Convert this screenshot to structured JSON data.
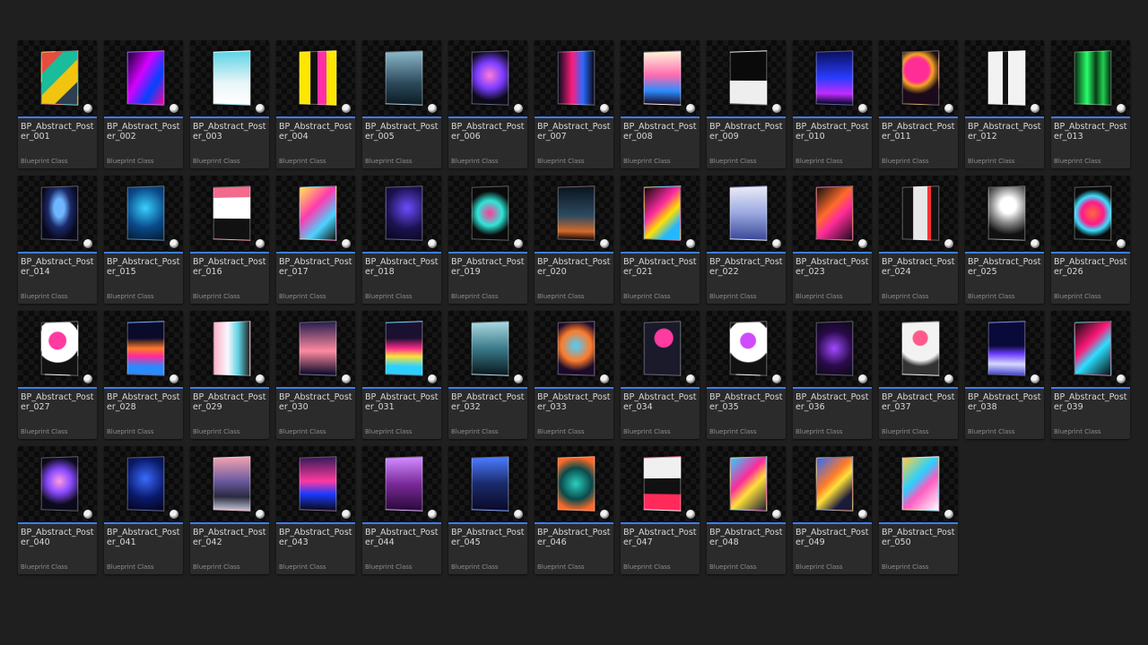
{
  "type_label": "Blueprint Class",
  "assets": [
    {
      "name": "BP_Abstract_Poster_001",
      "poster": "linear-gradient(135deg,#e74c3c 0 25%,#1abc9c 25% 50%,#f1c40f 50% 75%,#2c3e50 75%)"
    },
    {
      "name": "BP_Abstract_Poster_002",
      "poster": "linear-gradient(120deg,#1a0030,#d400ff 40%,#0044ff 70%,#ff0099)"
    },
    {
      "name": "BP_Abstract_Poster_003",
      "poster": "linear-gradient(180deg,#5fd3e6,#e9f6f8 60%,#ffffff)"
    },
    {
      "name": "BP_Abstract_Poster_004",
      "poster": "linear-gradient(90deg,#ffe600 0 30%,#111 30% 50%,#ff2ea6 50% 75%,#ffe600 75%)"
    },
    {
      "name": "BP_Abstract_Poster_005",
      "poster": "linear-gradient(180deg,#8ab6c8,#2c4a5c 60%,#0d1c26)"
    },
    {
      "name": "BP_Abstract_Poster_006",
      "poster": "radial-gradient(circle at 50% 45%,#ff7ad9,#7a3cff 40%,#0a0a18 75%)"
    },
    {
      "name": "BP_Abstract_Poster_007",
      "poster": "linear-gradient(90deg,#0a0a1a,#ff1c7d 40%,#2b6bff 70%,#0a0a1a)"
    },
    {
      "name": "BP_Abstract_Poster_008",
      "poster": "linear-gradient(180deg,#fef2d8,#ff6ab0 45%,#2b8cff 75%,#1a0a2a)"
    },
    {
      "name": "BP_Abstract_Poster_009",
      "poster": "linear-gradient(180deg,#0a0a0a 0 55%,#eeeeee 55%)"
    },
    {
      "name": "BP_Abstract_Poster_010",
      "poster": "linear-gradient(180deg,#0a1060,#2a3dff 50%,#c02cff 80%,#05052a)"
    },
    {
      "name": "BP_Abstract_Poster_011",
      "poster": "radial-gradient(circle at 40% 35%,#ff2d95 0 30%,#f5a623 40%,#1a0a1a 60%)"
    },
    {
      "name": "BP_Abstract_Poster_012",
      "poster": "linear-gradient(90deg,#f2f2f2 0 40%,#111 40% 55%,#f2f2f2 55%)"
    },
    {
      "name": "BP_Abstract_Poster_013",
      "poster": "linear-gradient(90deg,#062b10,#2aff6a 35%,#0a3a15 60%,#1fd04f 80%,#062b10)"
    },
    {
      "name": "BP_Abstract_Poster_014",
      "poster": "radial-gradient(ellipse at 50% 40%,#6fb6ff 0 20%,#1b2a6a 45%,#08081a 75%)"
    },
    {
      "name": "BP_Abstract_Poster_015",
      "poster": "radial-gradient(circle at 50% 40%,#38d0ff,#0a4a8a 55%,#041a33)"
    },
    {
      "name": "BP_Abstract_Poster_016",
      "poster": "linear-gradient(180deg,#f36b8c 0 20%,#ffffff 20% 60%,#111 60%)"
    },
    {
      "name": "BP_Abstract_Poster_017",
      "poster": "linear-gradient(135deg,#ffe84a,#ff3ab0 40%,#4ad3ff 70%,#111)"
    },
    {
      "name": "BP_Abstract_Poster_018",
      "poster": "radial-gradient(circle at 60% 40%,#6c4cff,#1b1250 55%,#06061a)"
    },
    {
      "name": "BP_Abstract_Poster_019",
      "poster": "radial-gradient(circle at 50% 50%,#ff3a9a,#2ee6d6 40%,#0a0a0a 70%)"
    },
    {
      "name": "BP_Abstract_Poster_020",
      "poster": "linear-gradient(180deg,#0a1520,#2d4a60 55%,#d46a2a 85%,#1a0a0a)"
    },
    {
      "name": "BP_Abstract_Poster_021",
      "poster": "linear-gradient(135deg,#0a0a0a,#ff2aa0 40%,#ffe100 60%,#25b7ff 80%)"
    },
    {
      "name": "BP_Abstract_Poster_022",
      "poster": "linear-gradient(180deg,#e8eaf6,#9aa8e0 50%,#3c4a9a)"
    },
    {
      "name": "BP_Abstract_Poster_023",
      "poster": "linear-gradient(135deg,#111,#ff6a2a 40%,#ff2a9a 60%,#1a0a1a)"
    },
    {
      "name": "BP_Abstract_Poster_024",
      "poster": "linear-gradient(90deg,#111 0 30%,#e8e8e8 30% 70%,#ff3030 70% 80%,#111 80%)"
    },
    {
      "name": "BP_Abstract_Poster_025",
      "poster": "radial-gradient(circle at 55% 35%,#ffffff 0 20%,#8a8a8a 45%,#111 75%)"
    },
    {
      "name": "BP_Abstract_Poster_026",
      "poster": "radial-gradient(circle at 50% 50%,#ff6a3a,#ff1a8a 35%,#3ae0ff 55%,#0a0a0a 75%)"
    },
    {
      "name": "BP_Abstract_Poster_027",
      "poster": "radial-gradient(circle at 45% 35%,#ff3aa0 0 22%,#ffffff 24% 55%,#111 57%)"
    },
    {
      "name": "BP_Abstract_Poster_028",
      "poster": "linear-gradient(180deg,#0a0a2a 0 30%,#ff7a2a 50%,#ff2a9a 65%,#2a8aff 85%)"
    },
    {
      "name": "BP_Abstract_Poster_029",
      "poster": "linear-gradient(90deg,#ffb0c8,#f8f8ff 40%,#5ad0e0 70%,#222)"
    },
    {
      "name": "BP_Abstract_Poster_030",
      "poster": "linear-gradient(180deg,#2a2050,#ff8aa0 55%,#0a0a2a)"
    },
    {
      "name": "BP_Abstract_Poster_031",
      "poster": "linear-gradient(180deg,#1a1030 0 30%,#ff2a8a 50%,#ffe13a 65%,#2ad0ff 85%)"
    },
    {
      "name": "BP_Abstract_Poster_032",
      "poster": "linear-gradient(180deg,#a8d8e0,#3a7a8a 50%,#0a1a20)"
    },
    {
      "name": "BP_Abstract_Poster_033",
      "poster": "radial-gradient(circle at 50% 45%,#4ad0ff,#ff7a2a 45%,#1a0a2a 75%)"
    },
    {
      "name": "BP_Abstract_Poster_034",
      "poster": "radial-gradient(circle at 55% 30%,#ff3aa0 0 22%,#1a1a2a 24%)"
    },
    {
      "name": "BP_Abstract_Poster_035",
      "poster": "radial-gradient(circle at 50% 35%,#d04aff 0 20%,#ffffff 22% 55%,#111 58%)"
    },
    {
      "name": "BP_Abstract_Poster_036",
      "poster": "radial-gradient(circle at 50% 50%,#a04aff,#2a0a4a 55%,#0a0a14)"
    },
    {
      "name": "BP_Abstract_Poster_037",
      "poster": "radial-gradient(circle at 50% 30%,#ff5a8a 0 18%,#f2f2f2 20% 55%,#333 70%)"
    },
    {
      "name": "BP_Abstract_Poster_038",
      "poster": "linear-gradient(180deg,#0a0a3a 0 45%,#6a3aff 60%,#d8d8ff 80%,#4a4ad0)"
    },
    {
      "name": "BP_Abstract_Poster_039",
      "poster": "linear-gradient(135deg,#0a0a0a,#ff1a7a 40%,#2ae0ff 60%,#0a0a0a)"
    },
    {
      "name": "BP_Abstract_Poster_040",
      "poster": "radial-gradient(circle at 50% 45%,#ff9ae0,#8a4aff 35%,#0a0a1a 70%)"
    },
    {
      "name": "BP_Abstract_Poster_041",
      "poster": "radial-gradient(circle at 50% 40%,#3a6aff,#0a1a6a 55%,#04041a)"
    },
    {
      "name": "BP_Abstract_Poster_042",
      "poster": "linear-gradient(180deg,#f0a0b0,#6a5aa0 45%,#2a2a40 75%,#c0c0d0)"
    },
    {
      "name": "BP_Abstract_Poster_043",
      "poster": "linear-gradient(180deg,#3a1a5a,#ff3aa0 45%,#1a3aff 70%,#0a0a1a)"
    },
    {
      "name": "BP_Abstract_Poster_044",
      "poster": "linear-gradient(180deg,#d08aff,#7a2a9a 50%,#2a0a3a)"
    },
    {
      "name": "BP_Abstract_Poster_045",
      "poster": "linear-gradient(180deg,#4a7aff,#1a2a6a 50%,#0a0a2a)"
    },
    {
      "name": "BP_Abstract_Poster_046",
      "poster": "radial-gradient(circle at 50% 50%,#2ad0c0,#0a4a4a 50%,#ff6a2a 85%)"
    },
    {
      "name": "BP_Abstract_Poster_047",
      "poster": "linear-gradient(180deg,#f0f0f0 0 40%,#111 40% 70%,#ff2a5a 70%)"
    },
    {
      "name": "BP_Abstract_Poster_048",
      "poster": "linear-gradient(135deg,#2ad0ff,#ff2a9a 40%,#ffe13a 60%,#1a1a3a)"
    },
    {
      "name": "BP_Abstract_Poster_049",
      "poster": "linear-gradient(135deg,#2a6aff,#ff7a2a 40%,#ffe13a 55%,#1a1a3a 80%)"
    },
    {
      "name": "BP_Abstract_Poster_050",
      "poster": "linear-gradient(135deg,#ffd03a,#2ad0ff 40%,#ff5ac0 60%,#ffffff)"
    }
  ]
}
